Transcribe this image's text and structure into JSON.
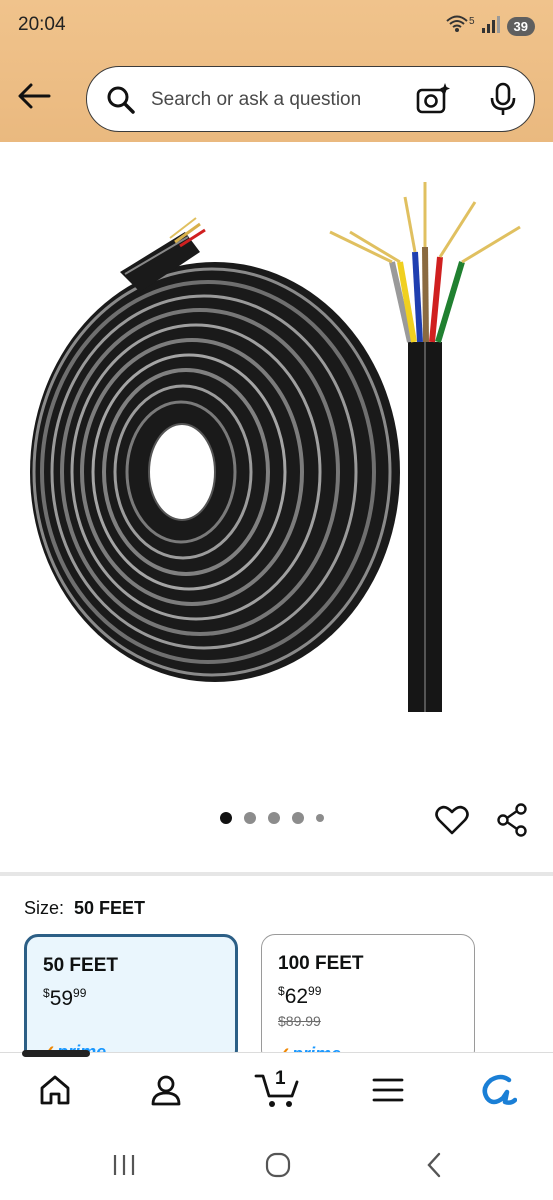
{
  "status_bar": {
    "time": "20:04",
    "signal_label": "5",
    "battery": "39"
  },
  "header": {
    "back_icon": "arrow-left-icon",
    "search": {
      "placeholder": "Search or ask a question",
      "value": ""
    },
    "camera_icon": "camera-sparkle-icon",
    "mic_icon": "microphone-icon"
  },
  "gallery": {
    "image_description_icon": "product-image",
    "dot_count": 5,
    "active_index": 0
  },
  "actions": {
    "wishlist_icon": "heart-icon",
    "share_icon": "share-icon"
  },
  "size": {
    "label": "Size:",
    "selected": "50 FEET",
    "options": [
      {
        "title": "50 FEET",
        "price_symbol": "$",
        "price_whole": "59",
        "price_fraction": "99",
        "old_price": "",
        "prime": "prime"
      },
      {
        "title": "100 FEET",
        "price_symbol": "$",
        "price_whole": "62",
        "price_fraction": "99",
        "old_price": "$89.99",
        "prime": "prime"
      }
    ]
  },
  "tab_bar": {
    "items": [
      "home-icon",
      "account-icon",
      "cart-icon",
      "menu-icon",
      "rufus-icon"
    ],
    "cart_count": "1"
  },
  "colors": {
    "header_bg": "#eab97f",
    "selected_border": "#2c5f86",
    "selected_bg": "#eaf6fd",
    "prime_blue": "#1a98ff",
    "prime_check": "#f08804"
  }
}
